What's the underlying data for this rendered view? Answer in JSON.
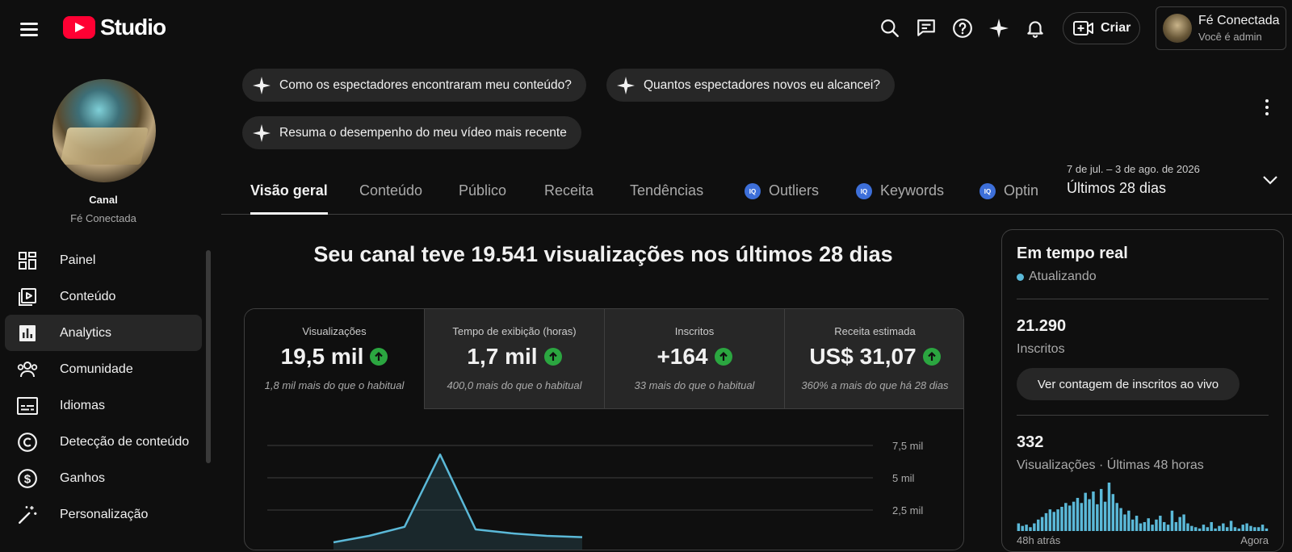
{
  "app": {
    "logo_text": "Studio"
  },
  "account": {
    "name": "Fé Conectada",
    "role": "Você é admin"
  },
  "header": {
    "create_label": "Criar"
  },
  "channel": {
    "label": "Canal",
    "name": "Fé Conectada"
  },
  "nav": [
    {
      "label": "Painel",
      "icon": "dashboard-icon"
    },
    {
      "label": "Conteúdo",
      "icon": "content-icon"
    },
    {
      "label": "Analytics",
      "icon": "analytics-icon",
      "active": true
    },
    {
      "label": "Comunidade",
      "icon": "community-icon"
    },
    {
      "label": "Idiomas",
      "icon": "subtitles-icon"
    },
    {
      "label": "Detecção de conteúdo",
      "icon": "copyright-icon"
    },
    {
      "label": "Ganhos",
      "icon": "earn-icon"
    },
    {
      "label": "Personalização",
      "icon": "magic-wand-icon"
    }
  ],
  "chips": [
    "Como os espectadores encontraram meu conteúdo?",
    "Quantos espectadores novos eu alcancei?",
    "Resuma o desempenho do meu vídeo mais recente"
  ],
  "tabs": [
    {
      "label": "Visão geral",
      "active": true
    },
    {
      "label": "Conteúdo"
    },
    {
      "label": "Público"
    },
    {
      "label": "Receita"
    },
    {
      "label": "Tendências"
    },
    {
      "label": "Outliers",
      "badge": "IQ"
    },
    {
      "label": "Keywords",
      "badge": "IQ"
    },
    {
      "label": "Optin",
      "badge": "IQ"
    }
  ],
  "date_range": {
    "sub": "7 de jul. – 3 de ago. de 2026",
    "main": "Últimos 28 dias"
  },
  "headline": "Seu canal teve 19.541 visualizações nos últimos 28 dias",
  "metrics": [
    {
      "label": "Visualizações",
      "value": "19,5 mil",
      "note": "1,8 mil mais do que o habitual"
    },
    {
      "label": "Tempo de exibição (horas)",
      "value": "1,7 mil",
      "note": "400,0 mais do que o habitual"
    },
    {
      "label": "Inscritos",
      "value": "+164",
      "note": "33 mais do que o habitual"
    },
    {
      "label": "Receita estimada",
      "value": "US$ 31,07",
      "note": "360% a mais do que há 28 dias"
    }
  ],
  "chart_data": {
    "type": "line",
    "y_ticks": [
      "7,5 mil",
      "5 mil",
      "2,5 mil"
    ],
    "ylim": [
      0,
      7500
    ],
    "x": [
      0,
      1,
      2,
      3,
      4,
      5,
      6,
      7
    ],
    "values": [
      0,
      500,
      1200,
      6800,
      1000,
      700,
      500,
      400
    ],
    "color": "#5bb9d8"
  },
  "realtime": {
    "title": "Em tempo real",
    "status": "Atualizando",
    "subscribers": "21.290",
    "subscribers_label": "Inscritos",
    "button": "Ver contagem de inscritos ao vivo",
    "views": "332",
    "views_label": "Visualizações · Últimas 48 horas",
    "axis_start": "48h atrás",
    "axis_end": "Agora",
    "bars": [
      6,
      4,
      5,
      3,
      6,
      9,
      11,
      14,
      17,
      15,
      17,
      19,
      22,
      20,
      23,
      26,
      22,
      30,
      25,
      31,
      21,
      33,
      23,
      38,
      29,
      22,
      18,
      13,
      16,
      9,
      12,
      6,
      7,
      10,
      5,
      9,
      12,
      7,
      5,
      16,
      7,
      11,
      13,
      6,
      4,
      3,
      2,
      5,
      3,
      7,
      2,
      4,
      6,
      3,
      8,
      3,
      2,
      5,
      6,
      4,
      3,
      3,
      5,
      2
    ]
  }
}
